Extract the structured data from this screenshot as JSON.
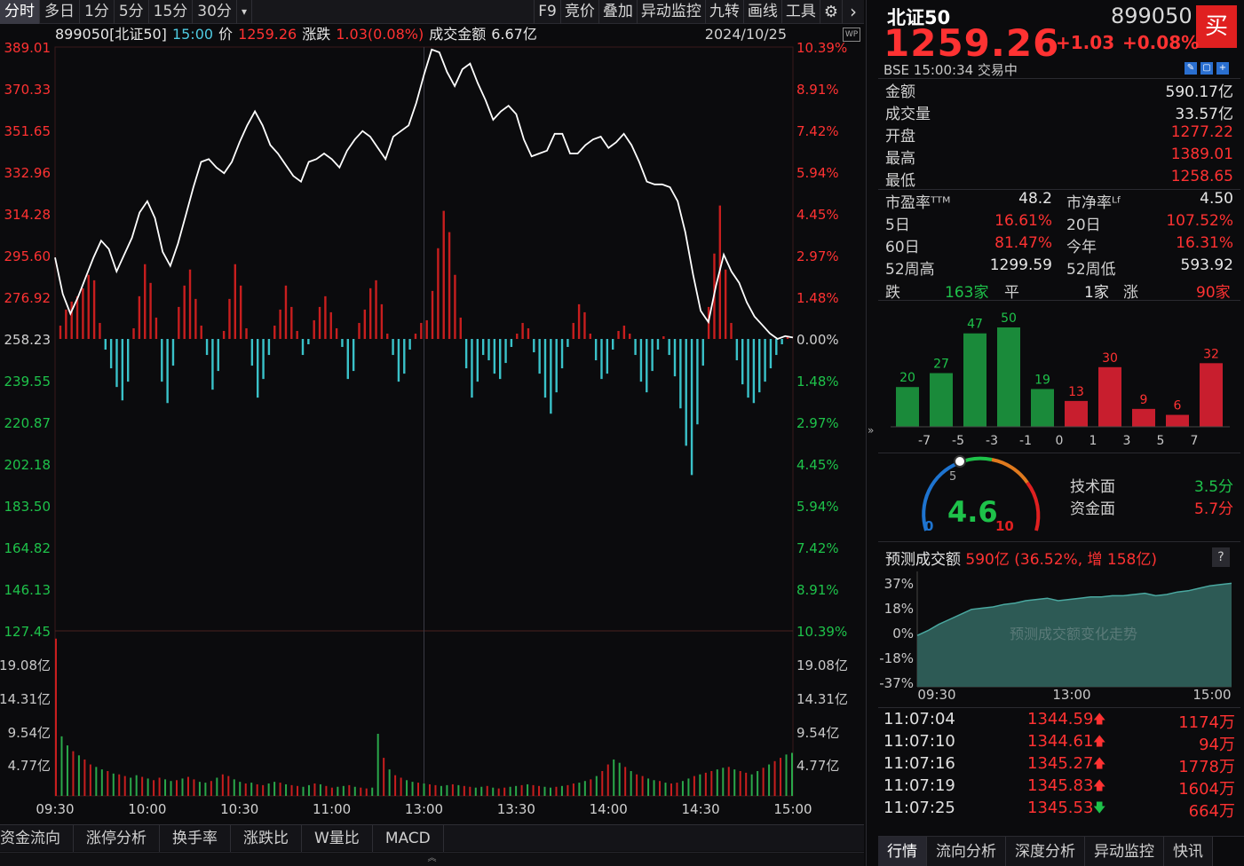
{
  "toolbar": {
    "tabs": [
      "分时",
      "多日",
      "1分",
      "5分",
      "15分",
      "30分"
    ],
    "dropdown": "▾",
    "tools": [
      "F9",
      "竞价",
      "叠加",
      "异动监控",
      "九转",
      "画线",
      "工具"
    ],
    "gear": "⚙",
    "next": "›"
  },
  "info": {
    "code_name": "899050[北证50]",
    "time": "15:00",
    "price_label": "价",
    "price": "1259.26",
    "change_label": "涨跌",
    "change": "1.03(0.08%)",
    "amount_label": "成交金额",
    "amount": "6.67亿",
    "date": "2024/10/25",
    "badge": "WP"
  },
  "chart_data": {
    "type": "line",
    "title": "899050[北证50] 分时",
    "x_labels": [
      "09:30",
      "10:00",
      "10:30",
      "11:00",
      "13:00",
      "13:30",
      "14:00",
      "14:30",
      "15:00"
    ],
    "y_left_labels": [
      "389.01",
      "370.33",
      "351.65",
      "332.96",
      "314.28",
      "295.60",
      "276.92",
      "258.23",
      "239.55",
      "220.87",
      "202.18",
      "183.50",
      "164.82",
      "146.13",
      "127.45"
    ],
    "y_right_labels": [
      "10.39%",
      "8.91%",
      "7.42%",
      "5.94%",
      "4.45%",
      "2.97%",
      "1.48%",
      "0.00%",
      "1.48%",
      "2.97%",
      "4.45%",
      "5.94%",
      "7.42%",
      "8.91%",
      "10.39%"
    ],
    "vol_labels": [
      "19.08亿",
      "14.31亿",
      "9.54亿",
      "4.77亿"
    ],
    "ylim_pct": [
      -10.39,
      10.39
    ],
    "price_pct": [
      2.9,
      1.6,
      0.9,
      1.5,
      2.2,
      2.9,
      3.5,
      3.2,
      2.4,
      3.0,
      3.6,
      4.5,
      4.9,
      4.3,
      3.1,
      2.6,
      3.4,
      4.4,
      5.4,
      6.3,
      6.4,
      6.1,
      5.9,
      6.3,
      7.0,
      7.6,
      8.1,
      7.6,
      6.9,
      6.6,
      6.2,
      5.8,
      5.6,
      6.3,
      6.4,
      6.6,
      6.4,
      6.1,
      6.7,
      7.1,
      7.4,
      7.2,
      6.8,
      6.4,
      7.2,
      7.4,
      7.6,
      8.4,
      9.4,
      10.3,
      10.2,
      9.5,
      9.0,
      9.6,
      9.8,
      9.1,
      8.5,
      7.8,
      8.1,
      8.3,
      8.0,
      7.1,
      6.5,
      6.6,
      6.7,
      7.3,
      7.3,
      6.6,
      6.6,
      6.9,
      7.1,
      7.2,
      6.8,
      7.0,
      7.3,
      6.9,
      6.3,
      5.6,
      5.5,
      5.5,
      5.4,
      4.9,
      3.8,
      2.3,
      1.0,
      0.6,
      1.9,
      3.0,
      2.4,
      2.0,
      1.3,
      0.8,
      0.5,
      0.2,
      0.0,
      0.1,
      0.05
    ],
    "breadth_bars": [
      {
        "v": 0.5
      },
      {
        "v": 1.1
      },
      {
        "v": 1.4
      },
      {
        "v": 1.6
      },
      {
        "v": 1.9
      },
      {
        "v": 2.4
      },
      {
        "v": 2.2
      },
      {
        "v": 0.6
      },
      {
        "v": -0.4
      },
      {
        "v": -1.1
      },
      {
        "v": -1.8
      },
      {
        "v": -2.3
      },
      {
        "v": -1.6
      },
      {
        "v": 0.4
      },
      {
        "v": 1.6
      },
      {
        "v": 2.8
      },
      {
        "v": 2.1
      },
      {
        "v": 0.8
      },
      {
        "v": -1.6
      },
      {
        "v": -2.4
      },
      {
        "v": -1.0
      },
      {
        "v": 1.2
      },
      {
        "v": 2.0
      },
      {
        "v": 2.6
      },
      {
        "v": 1.5
      },
      {
        "v": 0.5
      },
      {
        "v": -0.6
      },
      {
        "v": -1.9
      },
      {
        "v": -1.2
      },
      {
        "v": 0.3
      },
      {
        "v": 1.5
      },
      {
        "v": 2.8
      },
      {
        "v": 2.0
      },
      {
        "v": 0.4
      },
      {
        "v": -1.0
      },
      {
        "v": -2.2
      },
      {
        "v": -1.5
      },
      {
        "v": -0.6
      },
      {
        "v": 0.5
      },
      {
        "v": 1.1
      },
      {
        "v": 2.0
      },
      {
        "v": 1.2
      },
      {
        "v": 0.3
      },
      {
        "v": -0.6
      },
      {
        "v": -0.2
      },
      {
        "v": 0.7
      },
      {
        "v": 1.2
      },
      {
        "v": 1.6
      },
      {
        "v": 1.0
      },
      {
        "v": 0.4
      },
      {
        "v": -0.3
      },
      {
        "v": -1.5
      },
      {
        "v": -1.2
      },
      {
        "v": 0.6
      },
      {
        "v": 1.1
      },
      {
        "v": 1.9
      },
      {
        "v": 2.2
      },
      {
        "v": 1.3
      },
      {
        "v": 0.2
      },
      {
        "v": -0.6
      },
      {
        "v": -1.6
      },
      {
        "v": -1.3
      },
      {
        "v": -0.4
      },
      {
        "v": 0.2
      },
      {
        "v": 0.6
      },
      {
        "v": 0.7
      },
      {
        "v": 1.8
      },
      {
        "v": 3.4
      },
      {
        "v": 4.8
      },
      {
        "v": 4.0
      },
      {
        "v": 2.4
      },
      {
        "v": 0.8
      },
      {
        "v": -1.1
      },
      {
        "v": -2.2
      },
      {
        "v": -1.6
      },
      {
        "v": -0.6
      },
      {
        "v": -0.8
      },
      {
        "v": -1.3
      },
      {
        "v": -1.5
      },
      {
        "v": -0.9
      },
      {
        "v": -0.3
      },
      {
        "v": 0.2
      },
      {
        "v": 0.6
      },
      {
        "v": 0.4
      },
      {
        "v": -0.5
      },
      {
        "v": -1.3
      },
      {
        "v": -2.2
      },
      {
        "v": -2.8
      },
      {
        "v": -2.0
      },
      {
        "v": -1.1
      },
      {
        "v": -0.3
      },
      {
        "v": 0.6
      },
      {
        "v": 1.3
      },
      {
        "v": 1.0
      },
      {
        "v": 0.2
      },
      {
        "v": -0.8
      },
      {
        "v": -1.5
      },
      {
        "v": -1.3
      },
      {
        "v": -0.4
      },
      {
        "v": 0.3
      },
      {
        "v": 0.5
      },
      {
        "v": 0.2
      },
      {
        "v": -0.6
      },
      {
        "v": -1.6
      },
      {
        "v": -2.0
      },
      {
        "v": -1.2
      },
      {
        "v": -0.4
      },
      {
        "v": 0.1
      },
      {
        "v": -0.6
      },
      {
        "v": -1.4
      },
      {
        "v": -2.6
      },
      {
        "v": -4.0
      },
      {
        "v": -5.1
      },
      {
        "v": -3.2
      },
      {
        "v": -1.0
      },
      {
        "v": 1.2
      },
      {
        "v": 3.2
      },
      {
        "v": 5.0
      },
      {
        "v": 2.6
      },
      {
        "v": 0.6
      },
      {
        "v": -0.8
      },
      {
        "v": -1.7
      },
      {
        "v": -2.2
      },
      {
        "v": -2.4
      },
      {
        "v": -2.0
      },
      {
        "v": -1.6
      },
      {
        "v": -1.1
      },
      {
        "v": -0.6
      },
      {
        "v": -0.2
      },
      {
        "v": 0.1
      }
    ],
    "volume_max": 19.08,
    "volume": [
      19.0,
      7.2,
      6.1,
      5.4,
      4.9,
      4.4,
      3.8,
      3.5,
      3.2,
      3.0,
      2.7,
      2.6,
      2.4,
      2.2,
      2.5,
      2.3,
      2.1,
      1.9,
      2.2,
      2.0,
      1.8,
      1.9,
      2.1,
      2.3,
      2.0,
      1.7,
      1.6,
      1.8,
      2.2,
      2.6,
      2.4,
      2.0,
      1.7,
      1.5,
      1.6,
      1.4,
      1.3,
      1.5,
      1.7,
      1.6,
      1.4,
      1.3,
      1.2,
      1.1,
      1.3,
      1.5,
      1.4,
      1.2,
      1.0,
      1.1,
      1.2,
      1.3,
      1.1,
      1.0,
      0.9,
      1.0,
      7.5,
      4.6,
      3.2,
      2.5,
      2.2,
      1.9,
      1.7,
      1.6,
      1.5,
      1.4,
      1.3,
      1.2,
      1.3,
      1.4,
      1.3,
      1.2,
      1.1,
      1.0,
      1.1,
      1.2,
      1.0,
      0.9,
      1.0,
      1.1,
      1.2,
      1.3,
      1.4,
      1.3,
      1.2,
      1.1,
      1.0,
      1.1,
      1.2,
      1.3,
      1.5,
      1.6,
      1.8,
      2.0,
      2.4,
      3.0,
      3.8,
      4.4,
      4.0,
      3.5,
      3.0,
      2.6,
      2.4,
      2.1,
      1.9,
      1.8,
      1.6,
      1.5,
      1.6,
      1.8,
      2.1,
      2.4,
      2.6,
      2.8,
      3.0,
      3.2,
      3.4,
      3.5,
      3.2,
      3.0,
      2.8,
      2.6,
      3.0,
      3.4,
      3.8,
      4.2,
      4.6,
      5.0,
      5.2
    ]
  },
  "colors": {
    "up": "#ff3232",
    "down": "#1ec24a",
    "bar_up": "#c81e1e",
    "bar_down": "#3ac2c9",
    "line": "#ffffff",
    "grid": "#3a1a1a"
  },
  "bottom_tabs": [
    "资金流向",
    "涨停分析",
    "换手率",
    "涨跌比",
    "W量比",
    "MACD"
  ],
  "bottom_arrow": "︽",
  "collapse": "»",
  "right": {
    "name": "北证50",
    "code": "899050",
    "buy": "买",
    "price": "1259.26",
    "change": "+1.03",
    "pct": "+0.08%",
    "status": "BSE  15:00:34  交易中",
    "rows": [
      {
        "label": "金额",
        "value": "590.17亿",
        "color": "white"
      },
      {
        "label": "成交量",
        "value": "33.57亿",
        "color": "white"
      },
      {
        "label": "开盘",
        "value": "1277.22",
        "color": "red"
      },
      {
        "label": "最高",
        "value": "1389.01",
        "color": "red"
      },
      {
        "label": "最低",
        "value": "1258.65",
        "color": "red"
      }
    ],
    "pairs": [
      {
        "l1": "市盈率ᵀᵀᴹ",
        "v1": "48.2",
        "c1": "white",
        "l2": "市净率ᴸᶠ",
        "v2": "4.50",
        "c2": "white"
      },
      {
        "l1": "5日",
        "v1": "16.61%",
        "c1": "red",
        "l2": "20日",
        "v2": "107.52%",
        "c2": "red"
      },
      {
        "l1": "60日",
        "v1": "81.47%",
        "c1": "red",
        "l2": "今年",
        "v2": "16.31%",
        "c2": "red"
      },
      {
        "l1": "52周高",
        "v1": "1299.59",
        "c1": "white",
        "l2": "52周低",
        "v2": "593.92",
        "c2": "white"
      }
    ],
    "breadth": {
      "down_label": "跌",
      "down": "163家",
      "flat_label": "平",
      "flat": "1家",
      "up_label": "涨",
      "up": "90家"
    },
    "distribution": {
      "values": [
        20,
        27,
        47,
        50,
        19,
        13,
        30,
        9,
        6,
        32
      ],
      "x_labels": [
        "-7",
        "-5",
        "-3",
        "-1",
        "0",
        "1",
        "3",
        "5",
        "7"
      ]
    },
    "gauge": {
      "score": "4.6",
      "min": "0",
      "mid": "5",
      "max": "10",
      "tech_label": "技术面",
      "tech": "3.5分",
      "fund_label": "资金面",
      "fund": "5.7分"
    },
    "prediction": {
      "title": "预测成交额",
      "value": "590亿 (36.52%, 增 158亿)",
      "help": "?",
      "y_labels": [
        "37%",
        "18%",
        "0%",
        "-18%",
        "-37%"
      ],
      "x_labels": [
        "09:30",
        "13:00",
        "15:00"
      ],
      "watermark": "预测成交额变化走势"
    },
    "ticks": [
      {
        "time": "11:07:04",
        "price": "1344.59",
        "dir": "up",
        "vol": "1174万"
      },
      {
        "time": "11:07:10",
        "price": "1344.61",
        "dir": "up",
        "vol": "94万"
      },
      {
        "time": "11:07:16",
        "price": "1345.27",
        "dir": "up",
        "vol": "1778万"
      },
      {
        "time": "11:07:19",
        "price": "1345.83",
        "dir": "up",
        "vol": "1604万"
      },
      {
        "time": "11:07:25",
        "price": "1345.53",
        "dir": "down",
        "vol": "664万"
      }
    ],
    "tabs": [
      "行情",
      "流向分析",
      "深度分析",
      "异动监控",
      "快讯"
    ]
  }
}
